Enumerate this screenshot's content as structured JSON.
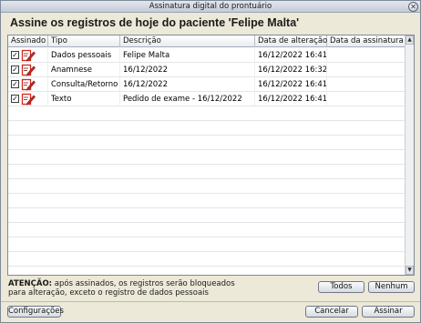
{
  "window": {
    "title": "Assinatura digital do prontuário",
    "close_glyph": "✕"
  },
  "heading": "Assine os registros de hoje do paciente 'Felipe Malta'",
  "table": {
    "columns": [
      "Assinado",
      "Tipo",
      "Descrição",
      "Data de alteração",
      "Data da assinatura"
    ],
    "rows": [
      {
        "checked": true,
        "tipo": "Dados pessoais",
        "descricao": "Felipe Malta",
        "data_alteracao": "16/12/2022 16:41",
        "data_assinatura": ""
      },
      {
        "checked": true,
        "tipo": "Anamnese",
        "descricao": "16/12/2022",
        "data_alteracao": "16/12/2022 16:32",
        "data_assinatura": ""
      },
      {
        "checked": true,
        "tipo": "Consulta/Retorno",
        "descricao": "16/12/2022",
        "data_alteracao": "16/12/2022 16:41",
        "data_assinatura": ""
      },
      {
        "checked": true,
        "tipo": "Texto",
        "descricao": "Pedido de exame - 16/12/2022",
        "data_alteracao": "16/12/2022 16:41",
        "data_assinatura": ""
      }
    ],
    "check_glyph": "✓",
    "row_icon": "sign-document-icon",
    "scroll_up": "▲",
    "scroll_down": "▼"
  },
  "warning": {
    "strong": "ATENÇÃO:",
    "line1": " após assinados, os registros serão bloqueados",
    "line2": "para alteração, exceto o registro de dados pessoais"
  },
  "buttons": {
    "todos": "Todos",
    "nenhum": "Nenhum",
    "configuracoes": "Configurações",
    "cancelar": "Cancelar",
    "assinar": "Assinar"
  },
  "colors": {
    "icon_red": "#d2281e",
    "icon_line": "#7a1a14"
  }
}
